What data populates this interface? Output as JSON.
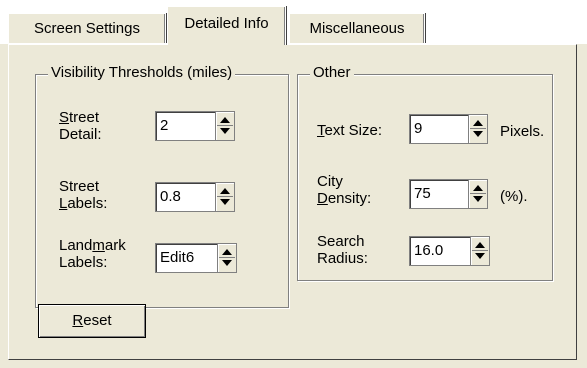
{
  "tabs": [
    {
      "label": "Screen Settings"
    },
    {
      "label": "Detailed Info"
    },
    {
      "label": "Miscellaneous"
    }
  ],
  "active_tab": "Detailed Info",
  "visibility_group": {
    "title": "Visibility Thresholds (miles)",
    "street_detail": {
      "label_line1": "Street",
      "label_line2": "Detail:",
      "value": "2"
    },
    "street_labels": {
      "label_line1": "Street",
      "label_line2": "Labels:",
      "value": "0.8"
    },
    "landmark_labels": {
      "label_line1": "Landmark",
      "label_line2": "Labels:",
      "value": "Edit6"
    }
  },
  "other_group": {
    "title": "Other",
    "text_size": {
      "label": "Text Size:",
      "value": "9",
      "unit": "Pixels."
    },
    "city_density": {
      "label_line1": "City",
      "label_line2": "Density:",
      "value": "75",
      "unit": "(%)."
    },
    "search_radius": {
      "label_line1": "Search",
      "label_line2": "Radius:",
      "value": "16.0"
    }
  },
  "reset_button": {
    "label": "Reset"
  }
}
